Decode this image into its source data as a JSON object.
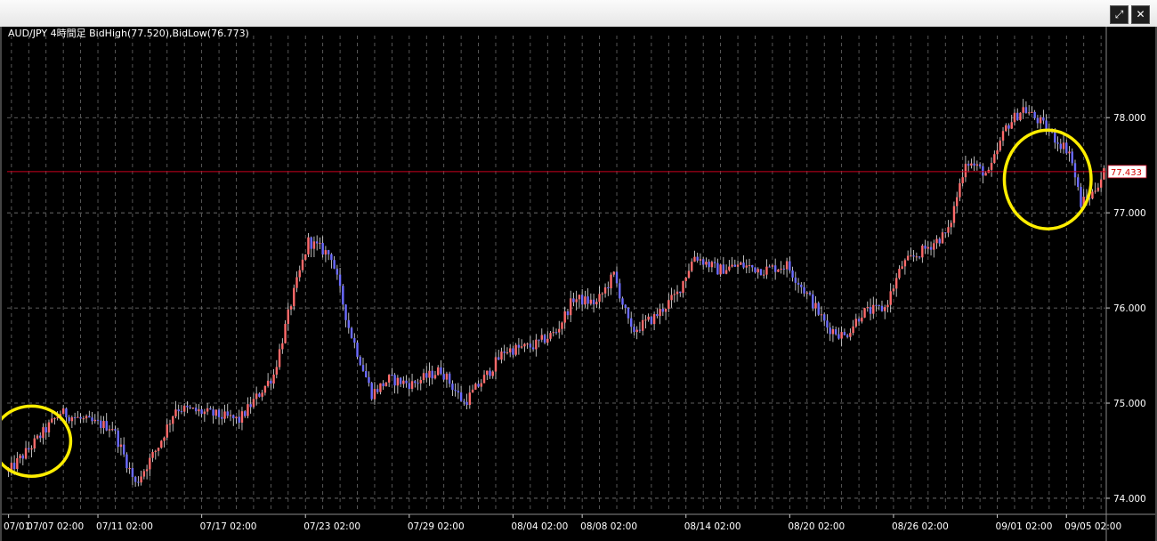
{
  "window": {
    "maximize_icon": "maximize-icon",
    "close_icon": "close-icon",
    "maximize_glyph": "⤢",
    "close_glyph": "✕"
  },
  "chart_data": {
    "type": "candlestick",
    "title": "AUD/JPY 4時間足  BidHigh(77.520),BidLow(76.773)",
    "bid_high": 77.52,
    "bid_low": 76.773,
    "current_price": 77.433,
    "current_price_label": "77.433",
    "ylim": [
      73.85,
      78.9
    ],
    "y_ticks": [
      {
        "value": 74.0,
        "label": "74.000"
      },
      {
        "value": 75.0,
        "label": "75.000"
      },
      {
        "value": 76.0,
        "label": "76.000"
      },
      {
        "value": 77.0,
        "label": "77.000"
      },
      {
        "value": 78.0,
        "label": "78.000"
      }
    ],
    "x_ticks": [
      {
        "index": 0,
        "label": "07/01"
      },
      {
        "index": 7,
        "label": "07/07 02:00"
      },
      {
        "index": 31,
        "label": "07/11 02:00"
      },
      {
        "index": 67,
        "label": "07/17 02:00"
      },
      {
        "index": 103,
        "label": "07/23 02:00"
      },
      {
        "index": 139,
        "label": "07/29 02:00"
      },
      {
        "index": 175,
        "label": "08/04 02:00"
      },
      {
        "index": 199,
        "label": "08/08 02:00"
      },
      {
        "index": 235,
        "label": "08/14 02:00"
      },
      {
        "index": 271,
        "label": "08/20 02:00"
      },
      {
        "index": 307,
        "label": "08/26 02:00"
      },
      {
        "index": 343,
        "label": "09/01 02:00"
      },
      {
        "index": 367,
        "label": "09/05 02:00"
      }
    ],
    "grid": true,
    "up_color": "#ff6a6a",
    "down_color": "#6b6bff",
    "price_line_color": "#c8001e",
    "highlight_color": "#ffee00",
    "highlights": [
      {
        "from_index": 0,
        "to_index": 16,
        "note_price_low": 74.25,
        "note_price_high": 74.95
      },
      {
        "from_index": 351,
        "to_index": 370,
        "note_price_low": 76.85,
        "note_price_high": 77.85
      }
    ],
    "anchors": [
      [
        0,
        74.28
      ],
      [
        8,
        74.55
      ],
      [
        18,
        74.9
      ],
      [
        28,
        74.8
      ],
      [
        36,
        74.75
      ],
      [
        44,
        74.15
      ],
      [
        52,
        74.55
      ],
      [
        58,
        74.95
      ],
      [
        68,
        74.9
      ],
      [
        80,
        74.82
      ],
      [
        92,
        75.3
      ],
      [
        98,
        76.05
      ],
      [
        104,
        76.7
      ],
      [
        112,
        76.55
      ],
      [
        118,
        75.8
      ],
      [
        126,
        75.1
      ],
      [
        132,
        75.25
      ],
      [
        140,
        75.2
      ],
      [
        150,
        75.35
      ],
      [
        158,
        75.0
      ],
      [
        166,
        75.3
      ],
      [
        172,
        75.55
      ],
      [
        182,
        75.6
      ],
      [
        190,
        75.75
      ],
      [
        196,
        76.1
      ],
      [
        204,
        76.05
      ],
      [
        210,
        76.35
      ],
      [
        216,
        75.75
      ],
      [
        224,
        75.9
      ],
      [
        232,
        76.15
      ],
      [
        238,
        76.55
      ],
      [
        246,
        76.4
      ],
      [
        254,
        76.45
      ],
      [
        262,
        76.4
      ],
      [
        270,
        76.45
      ],
      [
        278,
        76.1
      ],
      [
        284,
        75.8
      ],
      [
        290,
        75.7
      ],
      [
        296,
        75.95
      ],
      [
        304,
        76.0
      ],
      [
        310,
        76.45
      ],
      [
        318,
        76.62
      ],
      [
        326,
        76.8
      ],
      [
        332,
        77.55
      ],
      [
        340,
        77.4
      ],
      [
        346,
        77.9
      ],
      [
        352,
        78.1
      ],
      [
        358,
        77.95
      ],
      [
        364,
        77.75
      ],
      [
        368,
        77.65
      ],
      [
        372,
        77.1
      ],
      [
        376,
        77.2
      ],
      [
        380,
        77.43
      ]
    ]
  }
}
